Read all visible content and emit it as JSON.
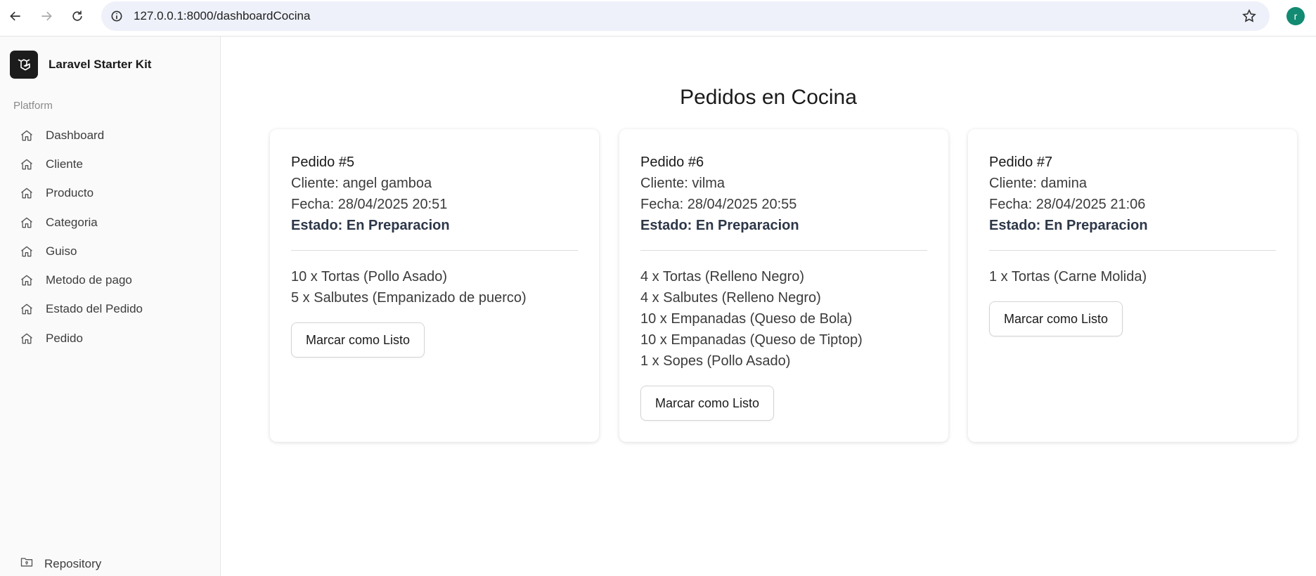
{
  "browser": {
    "url": "127.0.0.1:8000/dashboardCocina",
    "profile_initial": "r"
  },
  "sidebar": {
    "brand": "Laravel Starter Kit",
    "section_label": "Platform",
    "items": [
      {
        "label": "Dashboard"
      },
      {
        "label": "Cliente"
      },
      {
        "label": "Producto"
      },
      {
        "label": "Categoria"
      },
      {
        "label": "Guiso"
      },
      {
        "label": "Metodo de pago"
      },
      {
        "label": "Estado del Pedido"
      },
      {
        "label": "Pedido"
      }
    ],
    "repository": "Repository"
  },
  "main": {
    "title": "Pedidos en Cocina",
    "orders": [
      {
        "title": "Pedido #5",
        "cliente": "Cliente: angel gamboa",
        "fecha": "Fecha: 28/04/2025 20:51",
        "estado": "Estado: En Preparacion",
        "items": [
          "10 x Tortas (Pollo Asado)",
          "5 x Salbutes (Empanizado de puerco)"
        ],
        "button": "Marcar como Listo"
      },
      {
        "title": "Pedido #6",
        "cliente": "Cliente: vilma",
        "fecha": "Fecha: 28/04/2025 20:55",
        "estado": "Estado: En Preparacion",
        "items": [
          "4 x Tortas (Relleno Negro)",
          "4 x Salbutes (Relleno Negro)",
          "10 x Empanadas (Queso de Bola)",
          "10 x Empanadas (Queso de Tiptop)",
          "1 x Sopes (Pollo Asado)"
        ],
        "button": "Marcar como Listo"
      },
      {
        "title": "Pedido #7",
        "cliente": "Cliente: damina",
        "fecha": "Fecha: 28/04/2025 21:06",
        "estado": "Estado: En Preparacion",
        "items": [
          "1 x Tortas (Carne Molida)"
        ],
        "button": "Marcar como Listo"
      }
    ]
  }
}
